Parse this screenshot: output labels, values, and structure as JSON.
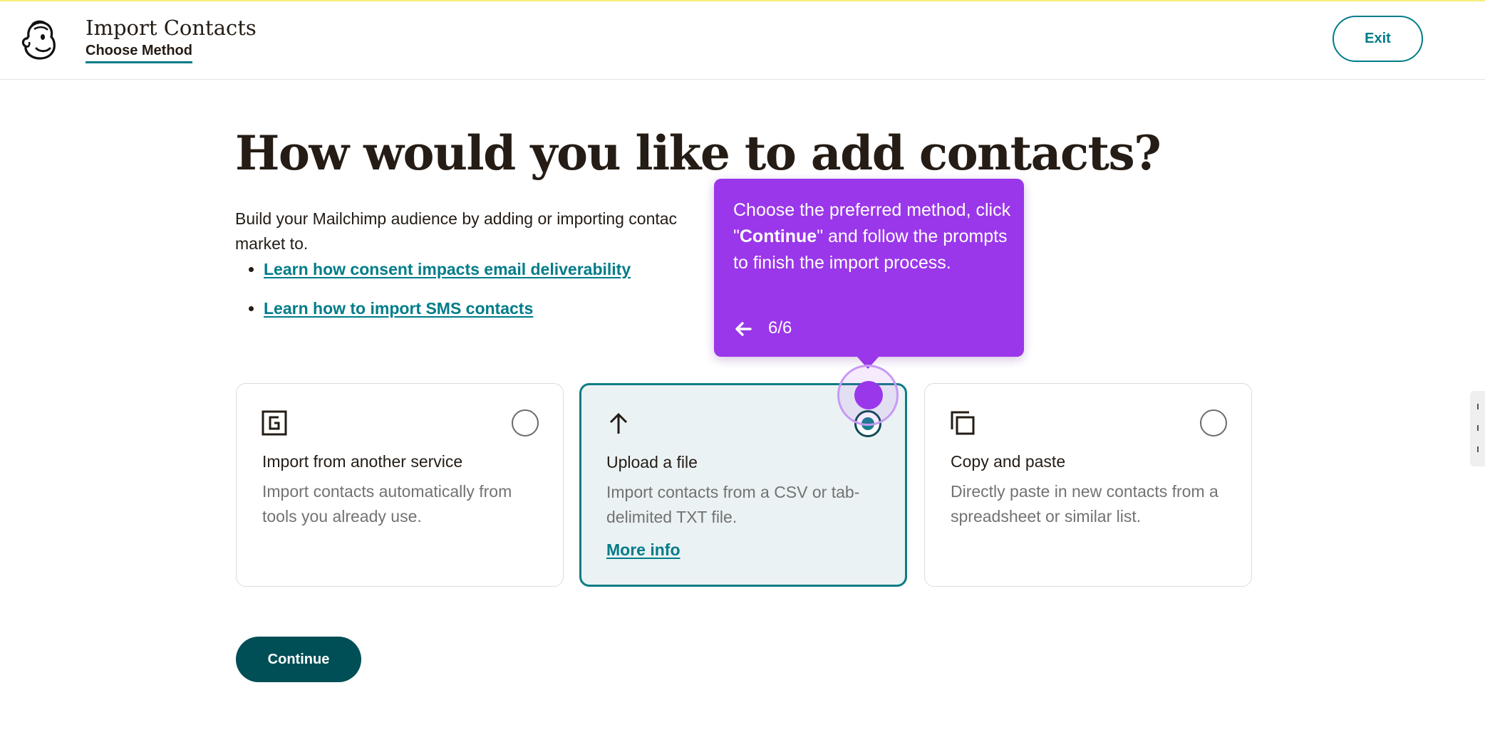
{
  "header": {
    "title": "Import Contacts",
    "subtitle": "Choose Method",
    "exit_label": "Exit",
    "logo_icon": "mailchimp-freddie-logo"
  },
  "main": {
    "headline": "How would you like to add contacts?",
    "intro_visible_start": "Build your Mailchimp audience by adding or importing contac",
    "intro_visible_end": "market to.",
    "links": [
      {
        "label": "Learn how consent impacts email deliverability"
      },
      {
        "label": "Learn how to import SMS contacts"
      }
    ]
  },
  "options": [
    {
      "icon": "import-service-icon",
      "title": "Import from another service",
      "description": "Import contacts automatically from tools you already use.",
      "selected": false
    },
    {
      "icon": "upload-arrow-icon",
      "title": "Upload a file",
      "description": "Import contacts from a CSV or tab-delimited TXT file.",
      "link": "More info",
      "selected": true
    },
    {
      "icon": "copy-icon",
      "title": "Copy and paste",
      "description": "Directly paste in new contacts from a spreadsheet or similar list.",
      "selected": false
    }
  ],
  "continue_label": "Continue",
  "tooltip": {
    "text_before": "Choose the preferred method, click \"",
    "text_bold": "Continue",
    "text_after": "\" and follow the prompts to finish the import process.",
    "step": "6/6",
    "back_icon": "arrow-left-icon"
  },
  "colors": {
    "accent": "#007c89",
    "primary_button": "#004e56",
    "tooltip": "#9a37ea",
    "selected_card_bg": "#ebf2f4",
    "top_strip": "#f6ef7c"
  }
}
